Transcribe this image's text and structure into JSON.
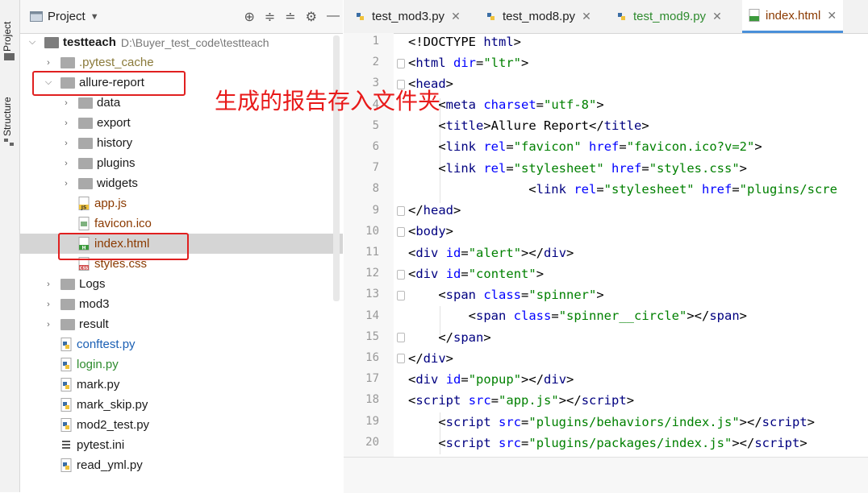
{
  "sidebar": {
    "project_tab": "Project",
    "structure_tab": "Structure"
  },
  "project_panel": {
    "title": "Project",
    "tools": [
      "target-icon",
      "expand-all-icon",
      "collapse-all-icon",
      "gear-icon",
      "minimize-icon"
    ],
    "root": {
      "name": "testteach",
      "path": "D:\\Buyer_test_code\\testteach"
    },
    "items": [
      {
        "label": ".pytest_cache"
      },
      {
        "label": "allure-report"
      },
      {
        "label": "data"
      },
      {
        "label": "export"
      },
      {
        "label": "history"
      },
      {
        "label": "plugins"
      },
      {
        "label": "widgets"
      },
      {
        "label": "app.js"
      },
      {
        "label": "favicon.ico"
      },
      {
        "label": "index.html"
      },
      {
        "label": "styles.css"
      },
      {
        "label": "Logs"
      },
      {
        "label": "mod3"
      },
      {
        "label": "result"
      },
      {
        "label": "conftest.py"
      },
      {
        "label": "login.py"
      },
      {
        "label": "mark.py"
      },
      {
        "label": "mark_skip.py"
      },
      {
        "label": "mod2_test.py"
      },
      {
        "label": "pytest.ini"
      },
      {
        "label": "read_yml.py"
      }
    ]
  },
  "annotation": "生成的报告存入文件夹",
  "editor_tabs": [
    {
      "label": "test_mod3.py"
    },
    {
      "label": "test_mod8.py"
    },
    {
      "label": "test_mod9.py"
    },
    {
      "label": "index.html"
    }
  ],
  "code": {
    "line_numbers": [
      "1",
      "2",
      "3",
      "4",
      "5",
      "6",
      "7",
      "8",
      "9",
      "10",
      "11",
      "12",
      "13",
      "14",
      "15",
      "16",
      "17",
      "18",
      "19",
      "20"
    ]
  },
  "colors": {
    "annotation": "#e81a1a",
    "tag": "#000080",
    "attr": "#0000ff",
    "string": "#008000",
    "selected_row": "#d5d5d5"
  }
}
